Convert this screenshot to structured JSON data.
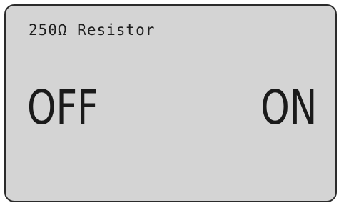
{
  "display": {
    "title": "250Ω Resistor",
    "softkeys": {
      "left_label": "OFF",
      "right_label": "ON"
    }
  }
}
